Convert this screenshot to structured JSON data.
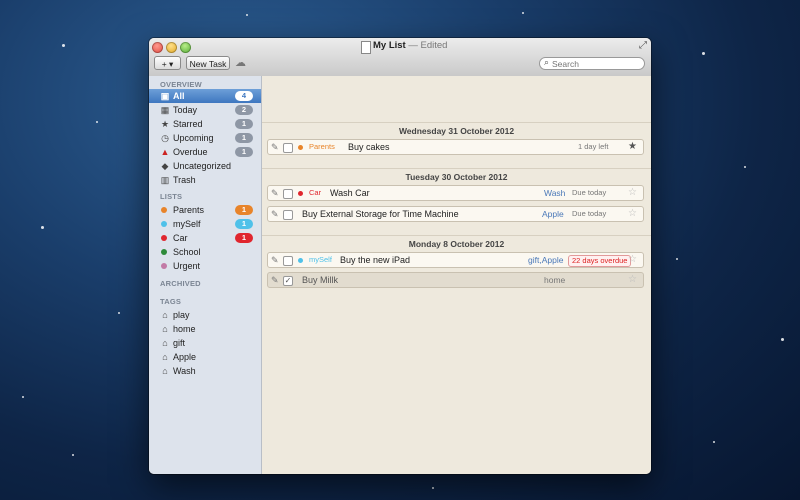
{
  "window": {
    "title": "My List",
    "separator": "—",
    "edited": "Edited"
  },
  "toolbar": {
    "add_label": "+ ▾",
    "new_task_label": "New Task",
    "search_placeholder": "Search"
  },
  "sidebar": {
    "overview_title": "OVERVIEW",
    "overview": [
      {
        "label": "All",
        "count": "4",
        "icon": "inbox-icon"
      },
      {
        "label": "Today",
        "count": "2",
        "icon": "calendar-icon"
      },
      {
        "label": "Starred",
        "count": "1",
        "icon": "star-icon"
      },
      {
        "label": "Upcoming",
        "count": "1",
        "icon": "clock-icon"
      },
      {
        "label": "Overdue",
        "count": "1",
        "icon": "warning-icon"
      },
      {
        "label": "Uncategorized",
        "icon": "pin-icon"
      },
      {
        "label": "Trash",
        "icon": "trash-icon"
      }
    ],
    "lists_title": "LISTS",
    "lists": [
      {
        "label": "Parents",
        "count": "1",
        "color": "#e8842a"
      },
      {
        "label": "mySelf",
        "count": "1",
        "color": "#4fc1e9"
      },
      {
        "label": "Car",
        "count": "1",
        "color": "#e0262e"
      },
      {
        "label": "School",
        "color": "#2e8b3a"
      },
      {
        "label": "Urgent",
        "color": "#c27aa6"
      }
    ],
    "archived_title": "ARCHIVED",
    "tags_title": "TAGS",
    "tags": [
      "play",
      "home",
      "gift",
      "Apple",
      "Wash"
    ]
  },
  "groups": [
    {
      "date": "Wednesday 31 October 2012",
      "tasks": [
        {
          "list": "Parents",
          "list_color": "#e8842a",
          "title": "Buy cakes",
          "tags": "",
          "due": "1 day left",
          "starred": true
        }
      ]
    },
    {
      "date": "Tuesday 30 October 2012",
      "tasks": [
        {
          "list": "Car",
          "list_color": "#e0262e",
          "title": "Wash Car",
          "tags": "Wash",
          "due": "Due today",
          "starred": false
        },
        {
          "list": "",
          "title": "Buy External Storage for Time Machine",
          "tags": "Apple",
          "due": "Due today",
          "starred": false
        }
      ]
    },
    {
      "date": "Monday 8 October 2012",
      "tasks": [
        {
          "list": "mySelf",
          "list_color": "#4fc1e9",
          "title": "Buy the new iPad",
          "tags": "gift,Apple",
          "due": "22 days overdue",
          "starred": false
        },
        {
          "list": "",
          "title": "Buy Millk",
          "tags": "home",
          "due": "",
          "starred": false,
          "done": true
        }
      ]
    }
  ]
}
